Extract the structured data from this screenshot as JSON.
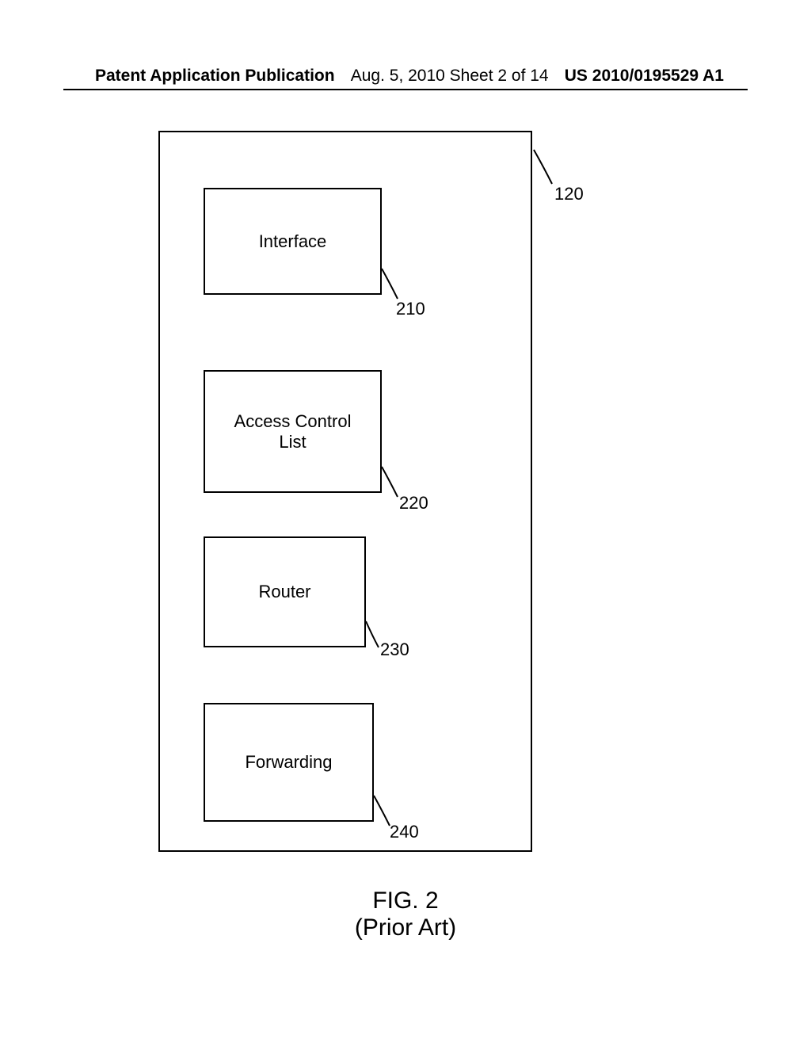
{
  "header": {
    "left": "Patent Application Publication",
    "center": "Aug. 5, 2010  Sheet 2 of 14",
    "right": "US 2010/0195529 A1"
  },
  "diagram": {
    "outer_ref": "120",
    "blocks": {
      "interface": {
        "label": "Interface",
        "ref": "210"
      },
      "acl": {
        "label": "Access Control\nList",
        "ref": "220"
      },
      "router": {
        "label": "Router",
        "ref": "230"
      },
      "forwarding": {
        "label": "Forwarding",
        "ref": "240"
      }
    }
  },
  "caption": {
    "line1": "FIG. 2",
    "line2": "(Prior Art)"
  }
}
